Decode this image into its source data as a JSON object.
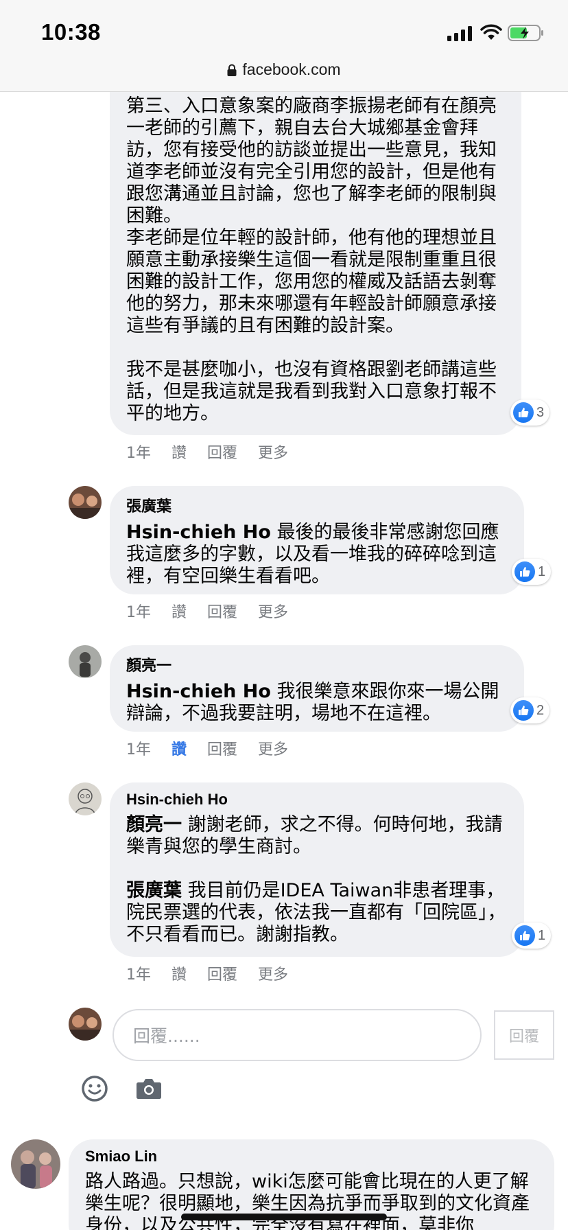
{
  "status_bar": {
    "time": "10:38"
  },
  "browser": {
    "url": "facebook.com"
  },
  "comments": [
    {
      "text": "第三、入口意象案的廠商李振揚老師有在顏亮一老師的引薦下，親自去台大城鄉基金會拜訪，您有接受他的訪談並提出一些意見，我知道李老師並沒有完全引用您的設計，但是他有跟您溝通並且討論，您也了解李老師的限制與困難。\n李老師是位年輕的設計師，他有他的理想並且願意主動承接樂生這個一看就是限制重重且很困難的設計工作，您用您的權威及話語去剝奪他的努力，那未來哪還有年輕設計師願意承接這些有爭議的且有困難的設計案。\n\n我不是甚麼咖小，也沒有資格跟劉老師講這些話，但是我這就是我看到我對入口意象打報不平的地方。",
      "likes": "3",
      "time": "1年",
      "like_label": "讚",
      "reply_label": "回覆",
      "more_label": "更多"
    },
    {
      "author": "張廣葉",
      "mention": "Hsin-chieh Ho",
      "text": " 最後的最後非常感謝您回應我這麼多的字數，以及看一堆我的碎碎唸到這裡，有空回樂生看看吧。",
      "likes": "1",
      "time": "1年",
      "like_label": "讚",
      "reply_label": "回覆",
      "more_label": "更多"
    },
    {
      "author": "顏亮一",
      "mention": "Hsin-chieh Ho",
      "text": " 我很樂意來跟你來一場公開辯論，不過我要註明，場地不在這裡。",
      "likes": "2",
      "time": "1年",
      "like_label": "讚",
      "reply_label": "回覆",
      "more_label": "更多"
    },
    {
      "author": "Hsin-chieh Ho",
      "mention": "顏亮一",
      "text": " 謝謝老師，求之不得。何時何地，我請樂青與您的學生商討。",
      "mention2": "張廣葉",
      "text2": " 我目前仍是IDEA Taiwan非患者理事，院民票選的代表，依法我一直都有「回院區」，不只看看而已。謝謝指教。",
      "likes": "1",
      "time": "1年",
      "like_label": "讚",
      "reply_label": "回覆",
      "more_label": "更多"
    }
  ],
  "reply_box": {
    "placeholder": "回覆......",
    "button_label": "回覆"
  },
  "next_comment": {
    "author": "Smiao Lin",
    "text": "路人路過。只想說，wiki怎麼可能會比現在的人更了解樂生呢？很明顯地，樂生因為抗爭而爭取到的文化資產身份，以及公共性，完全沒有寫在裡面，莫非你"
  },
  "colors": {
    "accent": "#3578e5",
    "bubble": "#eff0f3",
    "like_blue": "#1877f2"
  }
}
